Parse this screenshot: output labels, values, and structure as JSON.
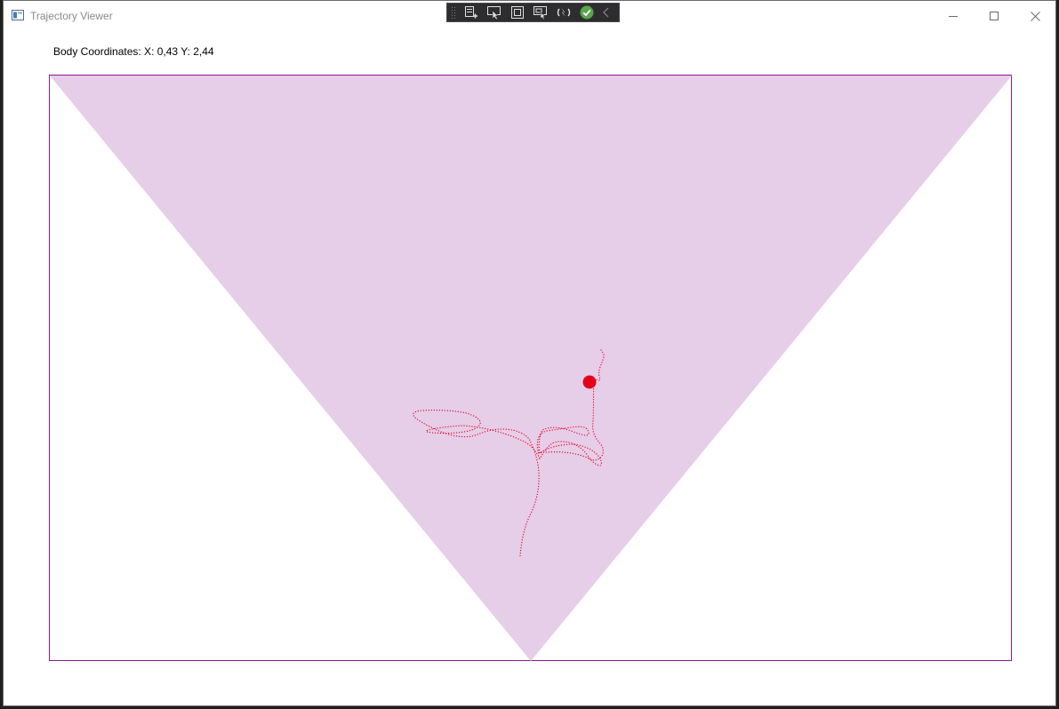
{
  "window": {
    "title": "Trajectory Viewer"
  },
  "title_icons": {
    "app": "app-window-icon",
    "minimize": "minimize-icon",
    "maximize": "maximize-icon",
    "close": "close-icon"
  },
  "debug_toolbar": {
    "buttons": [
      {
        "name": "live-visual-tree-icon"
      },
      {
        "name": "select-element-icon"
      },
      {
        "name": "display-layout-adorners-icon"
      },
      {
        "name": "track-focused-element-icon"
      },
      {
        "name": "hot-reload-icon"
      },
      {
        "name": "binding-ok-check-icon"
      },
      {
        "name": "collapse-chevron-icon"
      }
    ]
  },
  "status": {
    "coordinates_text": "Body Coordinates: X: 0,43 Y: 2,44"
  },
  "colors": {
    "field_fill": "#e6cde8",
    "frame_stroke": "#8b1a8b",
    "trajectory": "#e2001a",
    "body_marker": "#e2001a"
  },
  "viewer": {
    "body_marker": "red-filled-circle",
    "trajectory_style": "dotted-red-line"
  }
}
